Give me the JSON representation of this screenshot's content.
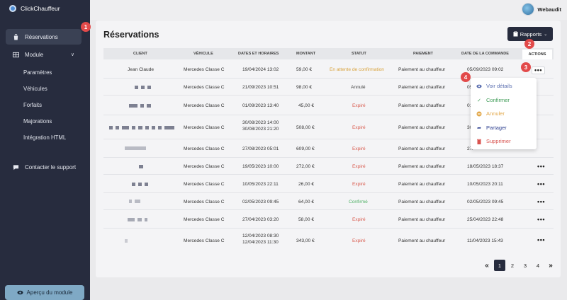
{
  "app": {
    "name": "ClickChauffeur"
  },
  "sidebar": {
    "items": [
      {
        "label": "Réservations",
        "icon": "bag-icon"
      },
      {
        "label": "Module",
        "icon": "table-icon"
      },
      {
        "label": "Contacter le support",
        "icon": "chat-icon"
      }
    ],
    "subitems": [
      "Paramètres",
      "Véhicules",
      "Forfaits",
      "Majorations",
      "Intégration HTML"
    ],
    "chevron": "∨",
    "preview_button": "Aperçu du module"
  },
  "user": {
    "name": "Webaudit"
  },
  "page": {
    "title": "Réservations"
  },
  "rapports_button": "Rapports",
  "table": {
    "headers": {
      "client": "CLIENT",
      "vehicule": "VÉHICULE",
      "dates": "DATES ET HORAIRES",
      "montant": "MONTANT",
      "statut": "STATUT",
      "paiement": "PAIEMENT",
      "date_commande": "DATE DE LA COMMANDE",
      "actions": "ACTIONS"
    },
    "rows": [
      {
        "client": "Jean Claude",
        "vehicule": "Mercedes Classe C",
        "dates": "19/04/2024 13:02",
        "dates2": "",
        "montant": "59,00 €",
        "statut": "En attente de confirmation",
        "paiement": "Paiement au chauffeur",
        "date_commande": "05/09/2023 09:02"
      },
      {
        "client": "",
        "vehicule": "Mercedes Classe C",
        "dates": "21/09/2023 10:51",
        "dates2": "",
        "montant": "98,00 €",
        "statut": "Annulé",
        "paiement": "Paiement au chauffeur",
        "date_commande": "05/"
      },
      {
        "client": "",
        "vehicule": "Mercedes Classe C",
        "dates": "01/09/2023 13:40",
        "dates2": "",
        "montant": "45,00 €",
        "statut": "Expiré",
        "paiement": "Paiement au chauffeur",
        "date_commande": "01/"
      },
      {
        "client": "",
        "vehicule": "Mercedes Classe C",
        "dates": "30/08/2023 14:00",
        "dates2": "30/08/2023 21:20",
        "montant": "508,00 €",
        "statut": "Expiré",
        "paiement": "Paiement au chauffeur",
        "date_commande": "30/"
      },
      {
        "client": "",
        "vehicule": "Mercedes Classe C",
        "dates": "27/08/2023 05:01",
        "dates2": "",
        "montant": "609,00 €",
        "statut": "Expiré",
        "paiement": "Paiement au chauffeur",
        "date_commande": "27/"
      },
      {
        "client": "",
        "vehicule": "Mercedes Classe C",
        "dates": "19/05/2023 10:00",
        "dates2": "",
        "montant": "272,00 €",
        "statut": "Expiré",
        "paiement": "Paiement au chauffeur",
        "date_commande": "18/05/2023 18:37"
      },
      {
        "client": "",
        "vehicule": "Mercedes Classe C",
        "dates": "10/05/2023 22:11",
        "dates2": "",
        "montant": "26,00 €",
        "statut": "Expiré",
        "paiement": "Paiement au chauffeur",
        "date_commande": "10/05/2023 20:11"
      },
      {
        "client": "",
        "vehicule": "Mercedes Classe C",
        "dates": "02/05/2023 09:45",
        "dates2": "",
        "montant": "64,00 €",
        "statut": "Confirmé",
        "paiement": "Paiement au chauffeur",
        "date_commande": "02/05/2023 09:45"
      },
      {
        "client": "",
        "vehicule": "Mercedes Classe C",
        "dates": "27/04/2023 03:20",
        "dates2": "",
        "montant": "58,00 €",
        "statut": "Expiré",
        "paiement": "Paiement au chauffeur",
        "date_commande": "25/04/2023 22:48"
      },
      {
        "client": "",
        "vehicule": "Mercedes Classe C",
        "dates": "12/04/2023 08:30",
        "dates2": "12/04/2023 11:30",
        "montant": "343,00 €",
        "statut": "Expiré",
        "paiement": "Paiement au chauffeur",
        "date_commande": "11/04/2023 15:43"
      }
    ]
  },
  "actions_menu": {
    "items": [
      {
        "label": "Voir détails",
        "icon": "eye-icon",
        "color": "#5b6fb0"
      },
      {
        "label": "Confirmer",
        "icon": "check-icon",
        "color": "#3e9b56"
      },
      {
        "label": "Annuler",
        "icon": "cancel-icon",
        "color": "#e2a748"
      },
      {
        "label": "Partager",
        "icon": "share-icon",
        "color": "#2d3f8f"
      },
      {
        "label": "Supprimer",
        "icon": "trash-icon",
        "color": "#d9534f"
      }
    ]
  },
  "pagination": {
    "prev": "«",
    "pages": [
      "1",
      "2",
      "3",
      "4"
    ],
    "current": "1",
    "next": "»"
  },
  "dots_label": "•••",
  "steps": [
    "1",
    "2",
    "3",
    "4"
  ],
  "colors": {
    "sidebar_bg": "#272c3e",
    "badge": "#e24a4a"
  }
}
